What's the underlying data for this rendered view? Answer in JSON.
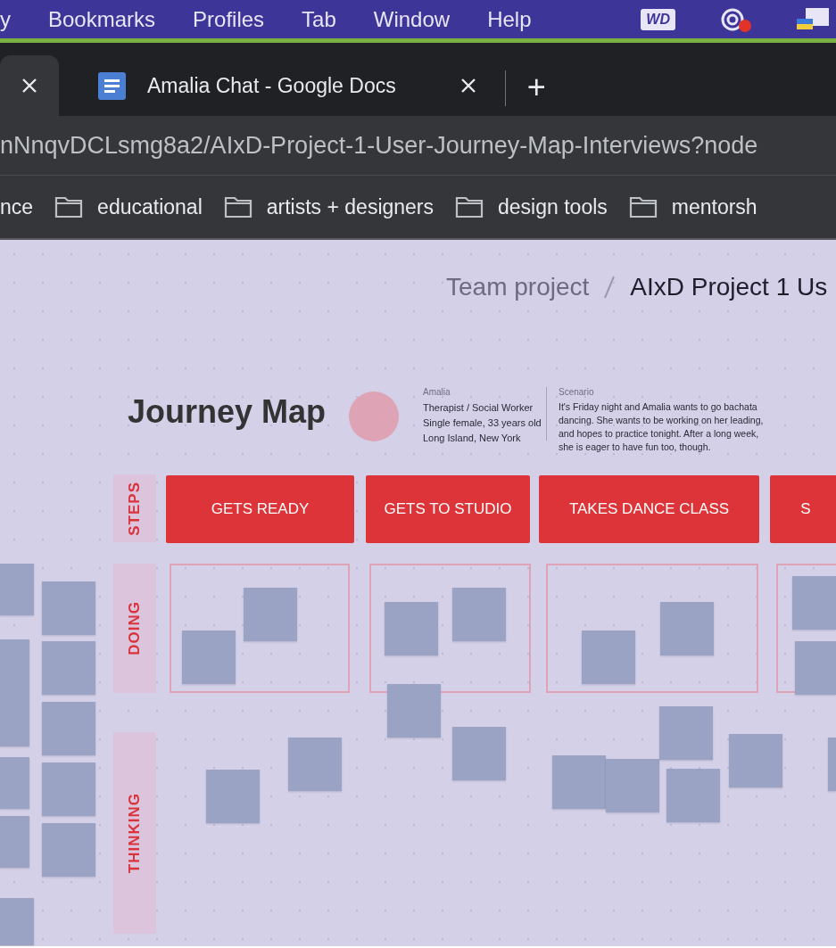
{
  "menu_bar": {
    "items": [
      "y",
      "Bookmarks",
      "Profiles",
      "Tab",
      "Window",
      "Help"
    ],
    "tray": {
      "wd_badge": "WD"
    }
  },
  "tabs": [
    {
      "selected": true
    },
    {
      "label": "Amalia Chat - Google Docs",
      "selected": false
    }
  ],
  "new_tab": "+",
  "address_bar": {
    "url": "nNnqvDCLsmg8a2/AIxD-Project-1-User-Journey-Map-Interviews?node"
  },
  "bookmarks": [
    {
      "label": "nce",
      "folder": false
    },
    {
      "label": "educational",
      "folder": true
    },
    {
      "label": "artists + designers",
      "folder": true
    },
    {
      "label": "design tools",
      "folder": true
    },
    {
      "label": "mentorsh",
      "folder": true
    }
  ],
  "breadcrumb": [
    "Team project",
    "AIxD Project 1 Us"
  ],
  "journey_map": {
    "title": "Journey Map",
    "persona": {
      "name": "Amalia",
      "lines": [
        "Therapist / Social Worker",
        "Single female, 33 years old",
        "Long Island, New York"
      ]
    },
    "scenario": {
      "heading": "Scenario",
      "text": "It's Friday night and Amalia wants to go bachata dancing. She wants to be working on her leading, and hopes to practice tonight. After a long week, she is eager to have fun too, though."
    },
    "lanes": [
      "STEPS",
      "DOING",
      "THINKING"
    ],
    "steps": [
      "GETS READY",
      "GETS TO STUDIO",
      "TAKES DANCE CLASS",
      "S"
    ]
  }
}
